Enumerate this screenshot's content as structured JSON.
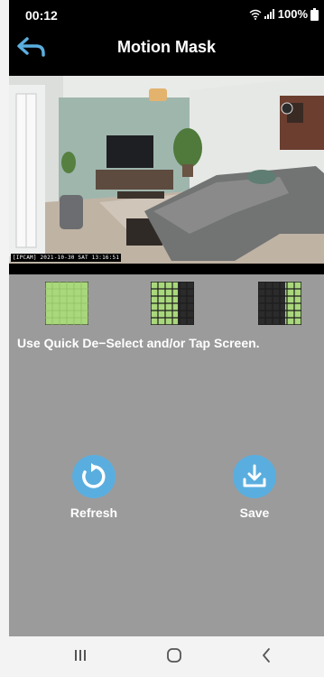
{
  "status_bar": {
    "time": "00:12",
    "battery": "100%"
  },
  "header": {
    "title": "Motion Mask"
  },
  "camera": {
    "osd_text": "[IPCAM] 2021-10-30 SAT 13:16:51"
  },
  "quick_deselect": {
    "options": [
      {
        "name": "select-all"
      },
      {
        "name": "deselect-right"
      },
      {
        "name": "deselect-left"
      }
    ],
    "hint": "Use Quick De−Select and/or Tap Screen."
  },
  "actions": {
    "refresh_label": "Refresh",
    "save_label": "Save"
  },
  "colors": {
    "accent": "#5aaedf",
    "mask_green": "#a9d77c",
    "mask_dark": "#2b2b2b",
    "panel": "#9b9b9b"
  }
}
